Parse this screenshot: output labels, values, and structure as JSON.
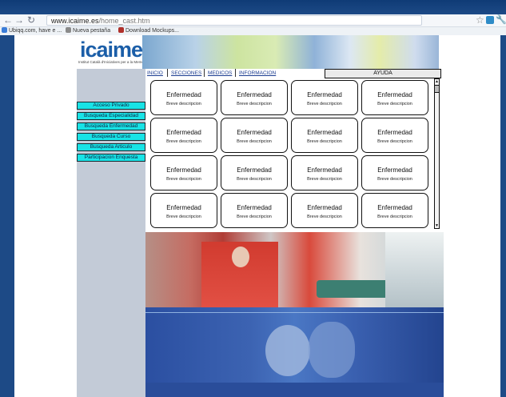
{
  "browser": {
    "url_host": "www.icaime.es",
    "url_path": "/home_cast.htm",
    "bookmarks": [
      {
        "label": "Ubiqq.com, have e ...",
        "color": "#3b7dd8"
      },
      {
        "label": "Nueva pestaña",
        "color": "#8a8a8a"
      },
      {
        "label": "Download Mockups...",
        "color": "#b0302a"
      }
    ]
  },
  "logo": {
    "text": "icaime",
    "tagline": "Institut Català d'Iniciatives per a la Memòria"
  },
  "nav": {
    "items": [
      "INICIO",
      "SECCIONES",
      "MEDICOS",
      "INFORMACION"
    ],
    "help": "AYUDA"
  },
  "sidebar": {
    "buttons": [
      "Acceso Privado",
      "Busqueda  Especialidad",
      "Busqueda   Enfermedad",
      "Busqueda  Curso",
      "Busqueda Articulo",
      "Participacion Enquesta"
    ]
  },
  "cards": [
    {
      "title": "Enfermedad",
      "desc": "Breve descripcion"
    },
    {
      "title": "Enfermedad",
      "desc": "Breve descripcion"
    },
    {
      "title": "Enfermedad",
      "desc": "Breve descripcion"
    },
    {
      "title": "Enfermedad",
      "desc": "Breve descripcion"
    },
    {
      "title": "Enfermedad",
      "desc": "Breve descripcion"
    },
    {
      "title": "Enfermedad",
      "desc": "Breve descripcion"
    },
    {
      "title": "Enfermedad",
      "desc": "Breve descripcion"
    },
    {
      "title": "Enfermedad",
      "desc": "Breve descripcion"
    },
    {
      "title": "Enfermedad",
      "desc": "Breve descripcion"
    },
    {
      "title": "Enfermedad",
      "desc": "Breve descripcion"
    },
    {
      "title": "Enfermedad",
      "desc": "Breve descripcion"
    },
    {
      "title": "Enfermedad",
      "desc": "Breve descripcion"
    },
    {
      "title": "Enfermedad",
      "desc": "Breve descripcion"
    },
    {
      "title": "Enfermedad",
      "desc": "Breve descripcion"
    },
    {
      "title": "Enfermedad",
      "desc": "Breve descripcion"
    },
    {
      "title": "Enfermedad",
      "desc": "Breve descripcion"
    }
  ],
  "icons": {
    "back": "back-arrow-icon",
    "forward": "forward-arrow-icon",
    "reload": "reload-icon",
    "star": "star-icon",
    "settings": "wrench-icon"
  },
  "colors": {
    "accent_button": "#18e3e6",
    "sidebar": "#c3cbd7",
    "outer": "#1d4a86",
    "link": "#1c3d91"
  }
}
